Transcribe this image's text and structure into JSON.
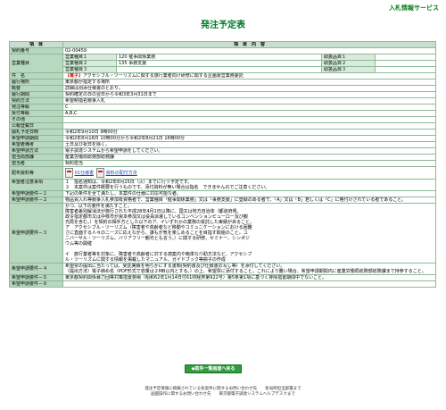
{
  "header": {
    "site_title": "入札情報サービス",
    "page_title": "発注予定表"
  },
  "table": {
    "col_item": "項　目",
    "col_content": "項　目　内　容",
    "contract_no_label": "契約番号",
    "contract_no": "02-00459",
    "business_type_label": "営業種目",
    "business_items": [
      {
        "label": "営業種目１",
        "value": "120 催事関係業務",
        "rank_label": "取扱品目１"
      },
      {
        "label": "営業種目２",
        "value": "135 事務支援",
        "rank_label": "取扱品目２"
      },
      {
        "label": "営業種目３",
        "value": "",
        "rank_label": "取扱品目３"
      }
    ],
    "subject_label": "件　名",
    "subject_tag": "【電子】",
    "subject_text": "アクセシブル・ツーリズムに関する旅行業者向け研修に関する企画運営業務委託",
    "place_label": "履行場所",
    "place": "東京都が指定する場所",
    "summary_label": "概要",
    "summary": "詳細は別添仕様書のとおり。",
    "period_label": "履行期間",
    "period": "契約確定の日の翌日から令和3年3月31日まで",
    "method_label": "契約方法",
    "method": "希望制指名競争入札",
    "grade_label": "発注等級",
    "grade": "C",
    "accept_grade_label": "受付等級",
    "accept_grade": "A,B,C",
    "other_label": "その他",
    "other": "",
    "notice_date_label": "公報登載日",
    "notice_date": "",
    "open_date_label": "開札予定日時",
    "open_date": "令和2年9月10日 9時00分",
    "apply_period_label": "希望申請期間",
    "apply_period": "令和2年8月18日 10時00分から令和2年8月21日 16時00分",
    "remarks_label": "希望者備考",
    "remarks": "土日及び祝日を除く。",
    "apply_method_label": "希望申請方法",
    "apply_method": "電子調達システムから希望申請をしてください。",
    "dept_label": "担当局部課",
    "dept": "産業労働局総務部総務課",
    "person_label": "担当者",
    "person": "契約担当",
    "doc_label": "配布資料等",
    "doc1": "01仕様書",
    "doc2": "資料の配付方法",
    "notes_label": "希望者注意事項",
    "notes": "１　指名通知は、令和2年8月25日（火）までに行う予定です。\n２　本案件は案件概要を行うものです。添付資料が無い場合は指名　できませんのでご注意ください。",
    "req1_label": "希望申請要件－１",
    "req1": "下記の条件を全て満たし、本案件の仕様に対応可能な者。",
    "req2_label": "希望申請要件－２",
    "req2": "物品買入れ等競争入札参加有資格者で、営業種目「催事関係業務」又は「事務支援」に登録のある者で、「A」又は「B」若しくは「C」に格付けされている者であること。",
    "req3_label": "希望申請要件－３",
    "req3": "かつ、以下の要件を満たすこと。\n障害者差別解消法が施行された平成28年4月1日以降に、国又は地方自治体（都道府県、\n政令指定都市又は中核市が資本参加又は役員派遣しているコンベンションビューロー及び観\n光局を含む。）を契約の相手方とした以下のア、イいずれかの業務の受託した実績があること。\nア　アクセシブル・ツーリズム（障害者や高齢者など移動やコミュニケーションにおける困難\nさに直面する人々のニーズに応えながら、誰もが気を楽しめることを目指す取組のこと。ユ\nニバーサル・ツーリズム、バリアフリー観光とも言う。）に関する研修、セミナー、シンポジ\nウム等の開催\n\nイ　旅行業者等を対象に、障害者や高齢者に対する適案内や簡単な介助方法など、アクセシブ\nル・ツーリズムに関する情報を掲載したマニュアル、ガイドブック等冊子の作成",
    "req4_label": "希望申請要件－４",
    "req4": "希望票の提出に当たっては、受託実績を明らかにする書類(契約書及び仕様書の写し等）を添付してください。\n（提出方法）電子締め名（PDF形式で容量は２MB以内とする。）の上、希望票に添付すること。これにより難い場合、希望申請期間内に産業労働局総務部総務課まで持参すること。",
    "req5_label": "希望申請要件－５",
    "req5": "東京都契約関係暴力団等対策措置要綱（昭和62年1月14日付61財経庶第922号）第5条第1項に基づく排除措置期間中でないこと。",
    "req6_label": "希望申請要件－６",
    "req6": ""
  },
  "back_button": "◆案件一覧画面へ戻る",
  "footer": {
    "line1": "発注予定情報に掲載されている各案件に関するお問い合わせ先　　各局所担当部署まで",
    "line2": "画面操作に関するお問い合わせ先　　東京都電子調達システムヘルプデスクまで"
  },
  "colors": {
    "label_bg": "#b9d8c0",
    "header_bg": "#c9dfcd",
    "accent": "#007a2a",
    "subject_tag": "#d01818"
  }
}
